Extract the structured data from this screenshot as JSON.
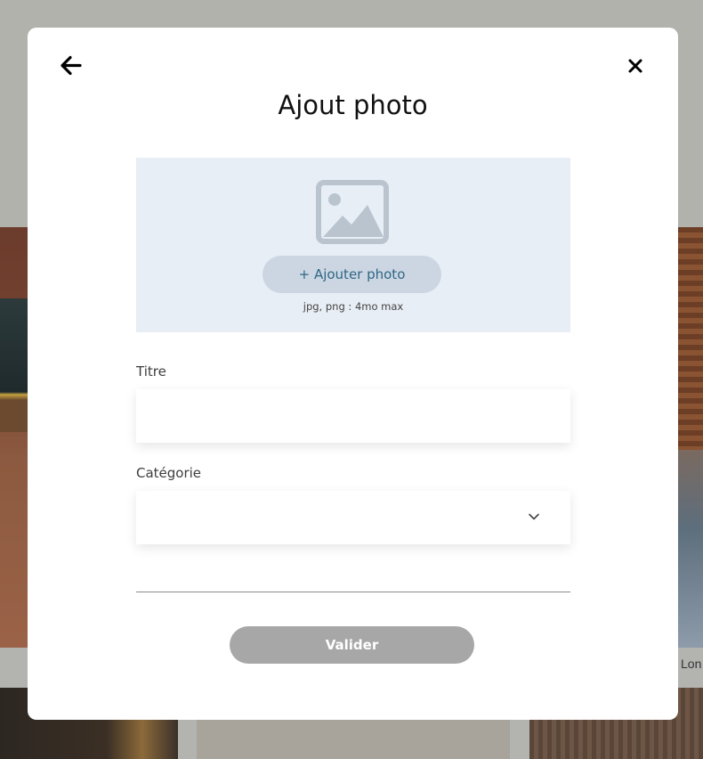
{
  "modal": {
    "title": "Ajout photo",
    "back_icon": "arrow-left-icon",
    "close_icon": "close-icon"
  },
  "upload": {
    "icon": "image-placeholder-icon",
    "button_label": "+ Ajouter photo",
    "hint": "jpg, png : 4mo max"
  },
  "form": {
    "title_label": "Titre",
    "title_value": "",
    "category_label": "Catégorie",
    "category_value": "",
    "category_icon": "chevron-down-icon",
    "submit_label": "Valider"
  },
  "background": {
    "caption_fragment": "Lon"
  },
  "colors": {
    "upload_bg": "#e8eef5",
    "upload_button_bg": "#cbd6e2",
    "upload_button_text": "#306685",
    "submit_disabled_bg": "#a7a7a7",
    "overlay": "#b3b3b0"
  }
}
